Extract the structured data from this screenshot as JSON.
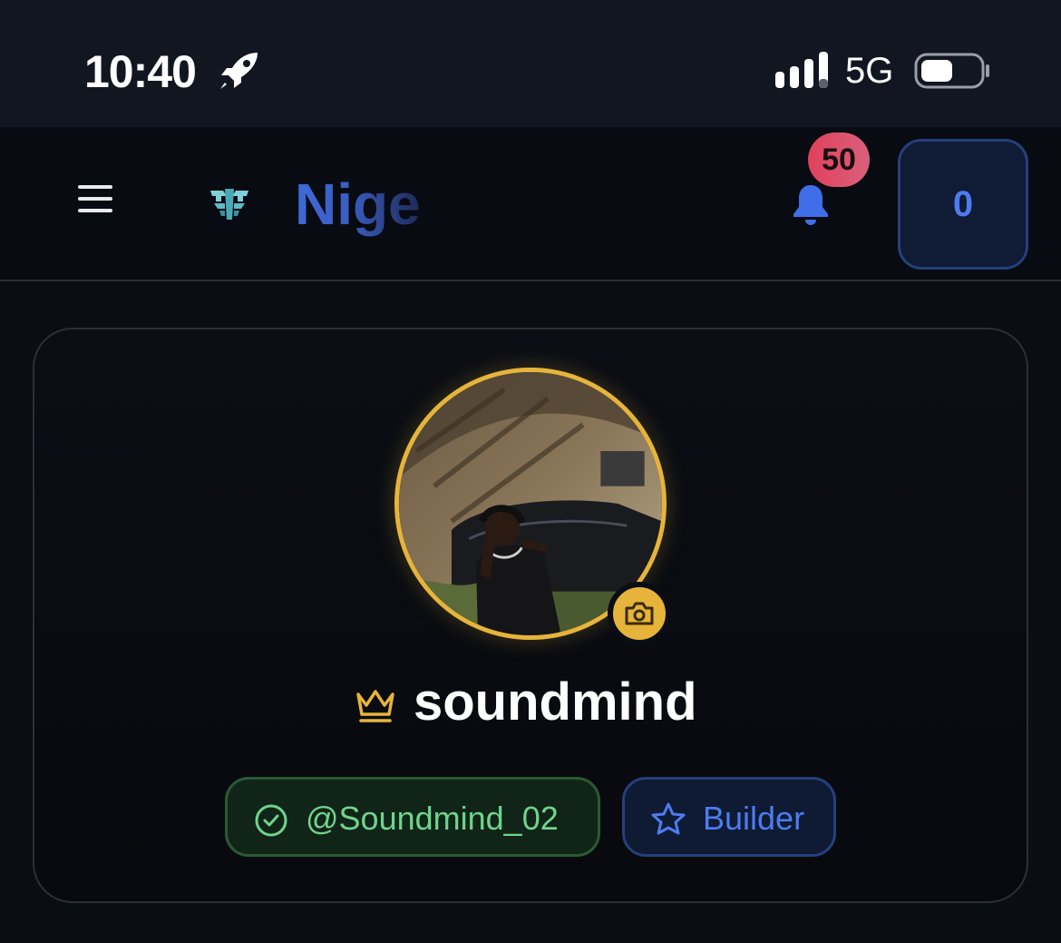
{
  "status_bar": {
    "time": "10:40",
    "time_icon": "rocket-icon",
    "network": "5G",
    "signal_icon": "signal-bars-icon",
    "battery_icon": "battery-icon"
  },
  "header": {
    "menu_icon": "hamburger-menu-icon",
    "logo_icon": "brand-logo-icon",
    "brand_name": "Nige",
    "notification_icon": "bell-icon",
    "notification_count": "50",
    "score_value": "0"
  },
  "profile": {
    "avatar_icon": "profile-photo",
    "camera_icon": "camera-icon",
    "crown_icon": "crown-icon",
    "username": "soundmind",
    "handle": "@Soundmind_02",
    "handle_icon": "check-circle-icon",
    "role": "Builder",
    "role_icon": "star-icon"
  },
  "colors": {
    "background": "#0a0d14",
    "accent_blue": "#4d7bf0",
    "gold": "#e6b43a",
    "verified_green": "#6fd48b",
    "badge_red": "#e0415b"
  }
}
